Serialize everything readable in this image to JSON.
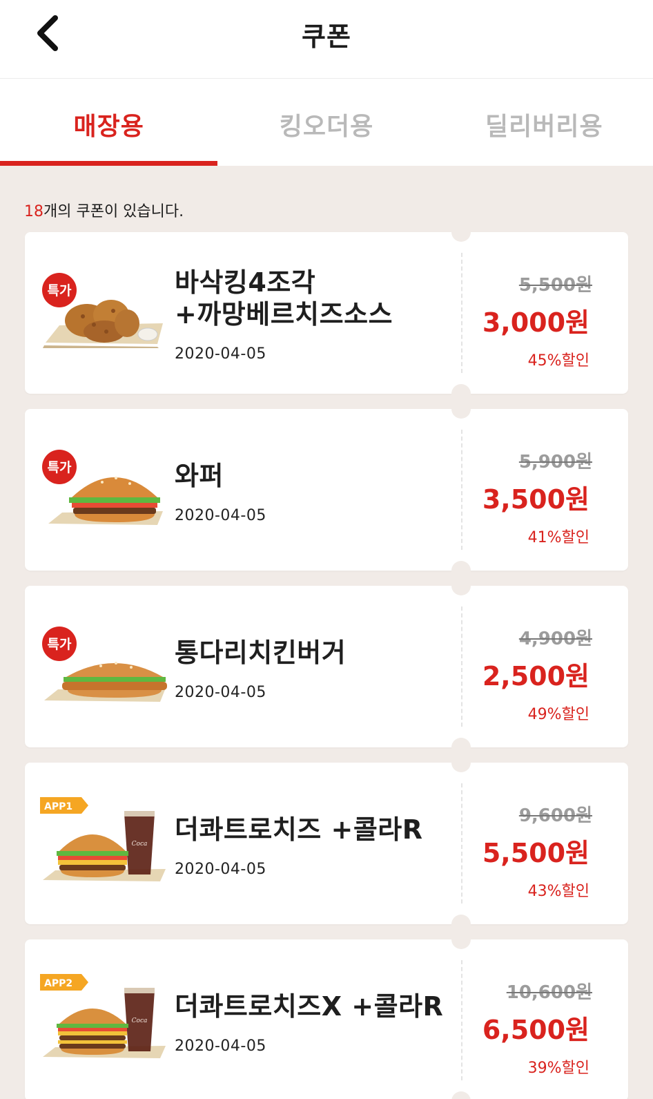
{
  "header": {
    "title": "쿠폰",
    "back_icon": "chevron-left-icon"
  },
  "tabs": [
    {
      "label": "매장용",
      "active": true
    },
    {
      "label": "킹오더용",
      "active": false
    },
    {
      "label": "딜리버리용",
      "active": false
    }
  ],
  "summary": {
    "count": "18",
    "text": "개의 쿠폰이 있습니다."
  },
  "colors": {
    "accent": "#d9231e",
    "background": "#f1ebe7",
    "badge_app": "#f5a623"
  },
  "coupons": [
    {
      "badge": "특가",
      "name_line1": "바삭킹4조각",
      "name_line2": "+까망베르치즈소스",
      "date": "2020-04-05",
      "original": "5,500원",
      "price": "3,000원",
      "discount": "45%할인"
    },
    {
      "badge": "특가",
      "name_line1": "와퍼",
      "name_line2": "",
      "date": "2020-04-05",
      "original": "5,900원",
      "price": "3,500원",
      "discount": "41%할인"
    },
    {
      "badge": "특가",
      "name_line1": "통다리치킨버거",
      "name_line2": "",
      "date": "2020-04-05",
      "original": "4,900원",
      "price": "2,500원",
      "discount": "49%할인"
    },
    {
      "badge": "APP1",
      "name_line1": "더콰트로치즈 +콜라R",
      "name_line2": "",
      "date": "2020-04-05",
      "original": "9,600원",
      "price": "5,500원",
      "discount": "43%할인"
    },
    {
      "badge": "APP2",
      "name_line1": "더콰트로치즈X +콜라R",
      "name_line2": "",
      "date": "2020-04-05",
      "original": "10,600원",
      "price": "6,500원",
      "discount": "39%할인"
    }
  ]
}
